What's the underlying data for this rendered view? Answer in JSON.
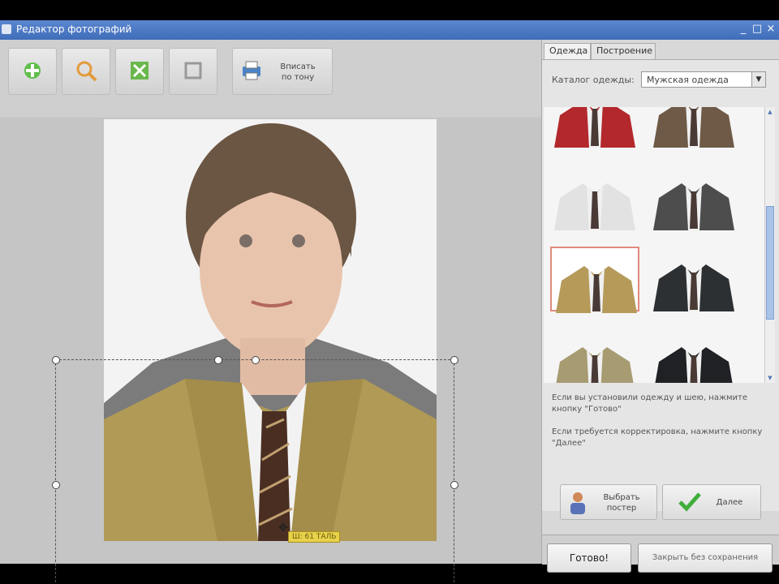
{
  "window": {
    "title": "Редактор фотографий",
    "controls": [
      "_",
      "□",
      "×"
    ]
  },
  "toolbar": {
    "buttons": [
      {
        "icon": "add-photo-icon"
      },
      {
        "icon": "zoom-icon"
      },
      {
        "icon": "fit-icon"
      },
      {
        "icon": "crop-icon"
      }
    ],
    "wide_button_label": "Вписать\nпо тону"
  },
  "photo": {
    "tooltip": "Ш: 61 ТАЛЬ"
  },
  "right_panel": {
    "tabs": [
      "Одежда",
      "Построение"
    ],
    "catalog_label": "Каталог одежды:",
    "catalog_value": "Мужская одежда",
    "suits": [
      {
        "name": "red-shirt",
        "color": "#b3282c"
      },
      {
        "name": "brown-suit",
        "color": "#6e5a47"
      },
      {
        "name": "white-shirt",
        "color": "#e2e2e2"
      },
      {
        "name": "grey-suit",
        "color": "#4d4d4d"
      },
      {
        "name": "tan-suit",
        "color": "#b59a5a",
        "selected": true
      },
      {
        "name": "dark-suit",
        "color": "#2d3033"
      },
      {
        "name": "khaki-suit",
        "color": "#a79b72"
      },
      {
        "name": "black-suit",
        "color": "#1f2124"
      }
    ],
    "hint1": "Если вы установили одежду и шею, нажмите кнопку \"Готово\"",
    "hint2": "Если требуется корректировка, нажмите кнопку \"Далее\"",
    "choose_button": "Выбрать\nпостер",
    "next_button": "Далее",
    "done_button": "Готово!",
    "close_button": "Закрыть без сохранения"
  },
  "colors": {
    "titlebar": "#4a77c4",
    "selected_border": "#e08a7c",
    "tooltip_bg": "#e8d24a"
  }
}
